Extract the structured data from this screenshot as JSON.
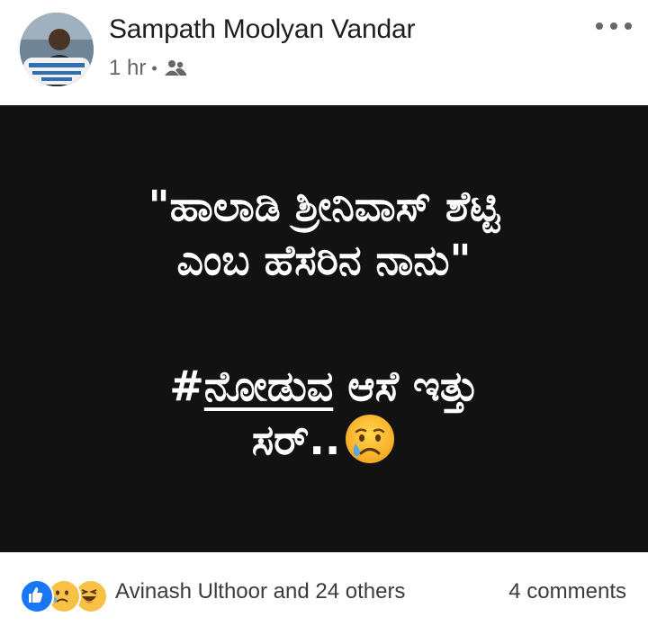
{
  "post": {
    "author": "Sampath Moolyan Vandar",
    "time": "1 hr",
    "separator": "•",
    "audience_icon": "friends-icon",
    "more_icon": "more-dots-icon"
  },
  "image": {
    "line1": "\"ಹಾಲಾಡಿ ಶ್ರೀನಿವಾಸ್ ಶೆಟ್ಟಿ",
    "line2": "ಎಂಬ ಹೆಸರಿನ ನಾನು\"",
    "hash_prefix": "#",
    "hash_word": "ನೋಡುವ",
    "line3_rest": " ಆಸೆ ಇತ್ತು",
    "line4": "ಸರ್..",
    "emoji": "crying-face-emoji",
    "background_color": "#121212",
    "text_color": "#ffffff"
  },
  "footer": {
    "reaction_icons": [
      "like-icon",
      "sad-icon",
      "haha-icon"
    ],
    "reactors": "Avinash Ulthoor and 24 others",
    "comments": "4 comments"
  }
}
